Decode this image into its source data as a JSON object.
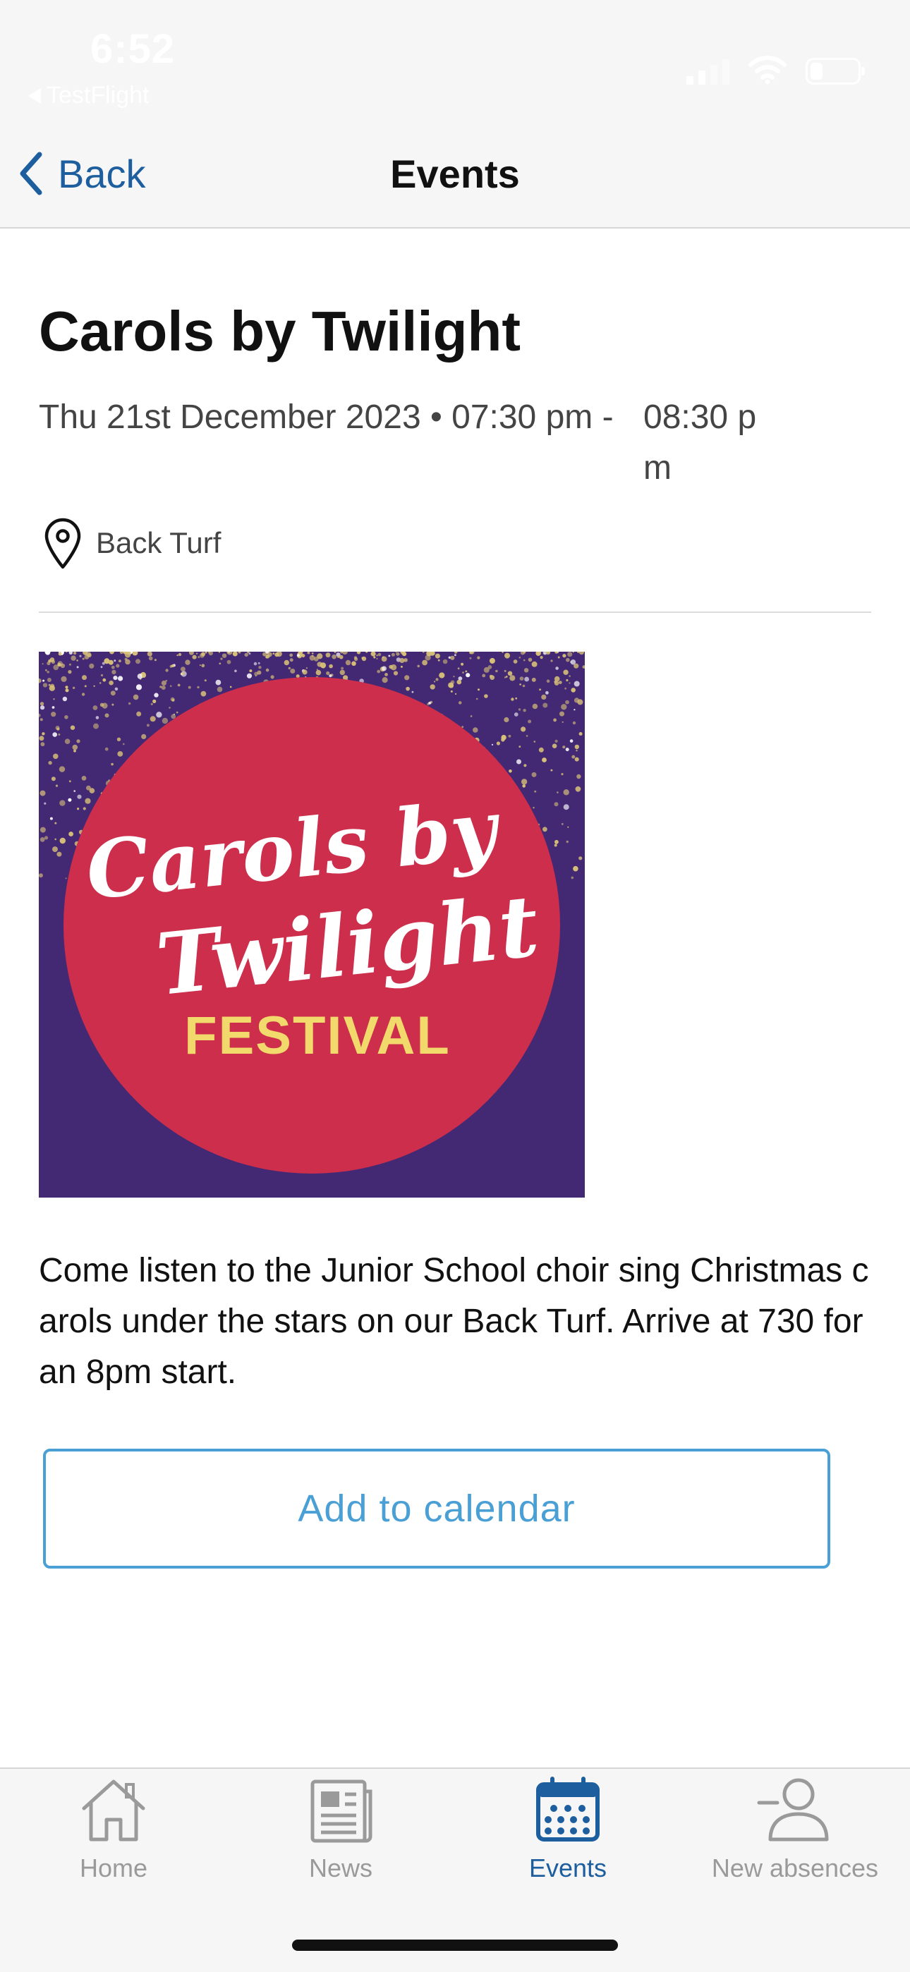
{
  "status_bar": {
    "time": "6:52",
    "return_app": "TestFlight",
    "signal_bars": 2,
    "battery_level": 0.25
  },
  "nav": {
    "back_label": "Back",
    "title": "Events"
  },
  "event": {
    "title": "Carols by Twilight",
    "date_start": "Thu 21st December 2023 • 07:30 pm -",
    "time_end": "08:30 pm",
    "location": "Back Turf",
    "poster": {
      "line1": "Carols by",
      "line2": "Twilight",
      "line3": "FESTIVAL",
      "colors": {
        "background": "#432874",
        "circle": "#cc2e4c",
        "sparkle": "#d8c178",
        "script_text": "#ffffff",
        "festival_text": "#f2d96b"
      }
    },
    "description": "Come listen to the Junior School choir sing Christmas carols under the stars on our Back Turf. Arrive at 730 for an 8pm start.",
    "calendar_button": "Add to calendar"
  },
  "tabs": [
    {
      "label": "Home",
      "icon": "house-icon",
      "active": false
    },
    {
      "label": "News",
      "icon": "newspaper-icon",
      "active": false
    },
    {
      "label": "Events",
      "icon": "calendar-icon",
      "active": true
    },
    {
      "label": "New absences",
      "icon": "person-minus-icon",
      "active": false
    }
  ],
  "colors": {
    "accent": "#1d5e9e",
    "button": "#4a9fd5",
    "inactive": "#9a9a9a",
    "bar_background": "#f6f6f6"
  }
}
